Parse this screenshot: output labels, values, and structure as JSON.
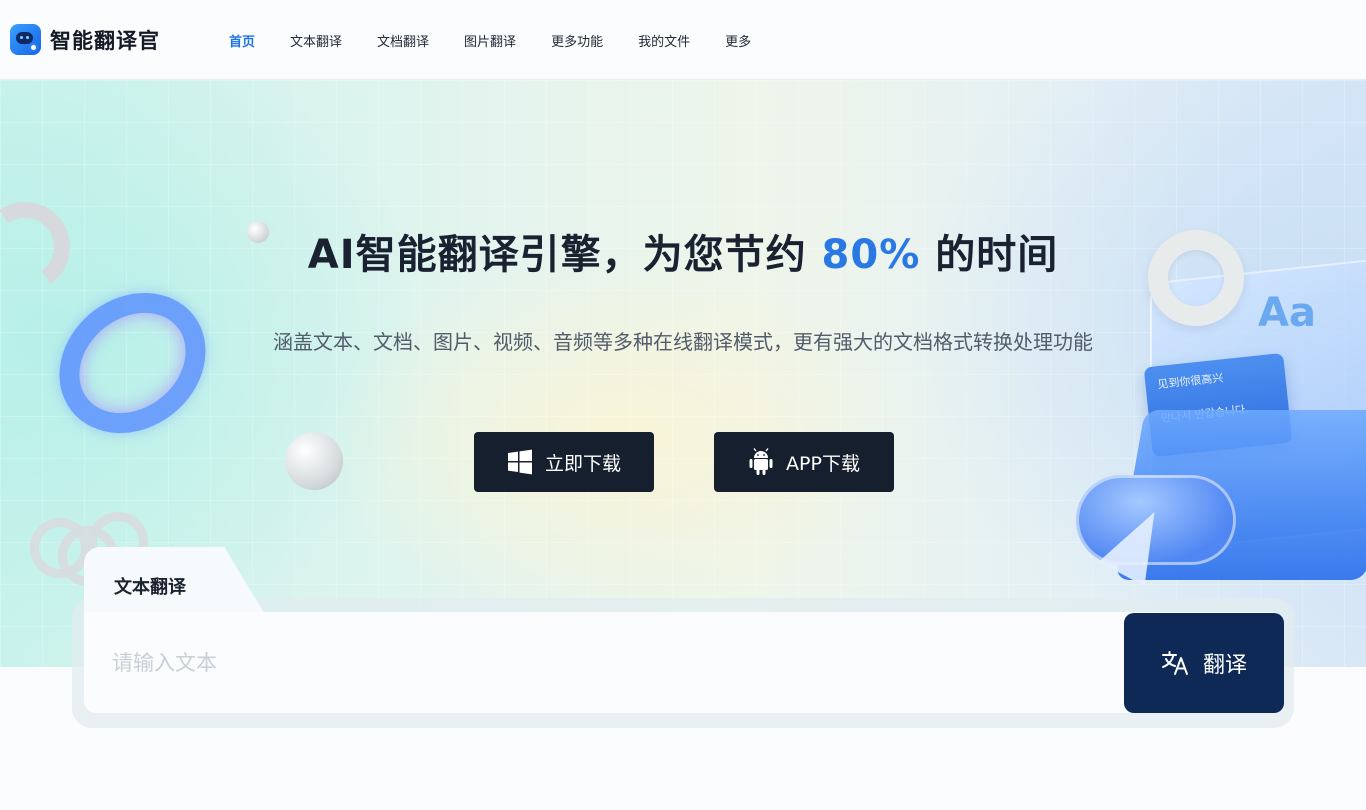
{
  "app": {
    "name": "智能翻译官"
  },
  "nav": {
    "items": [
      {
        "label": "首页",
        "active": true
      },
      {
        "label": "文本翻译"
      },
      {
        "label": "文档翻译"
      },
      {
        "label": "图片翻译"
      },
      {
        "label": "更多功能"
      },
      {
        "label": "我的文件"
      },
      {
        "label": "更多"
      }
    ]
  },
  "hero": {
    "title_prefix": "AI智能翻译引擎，为您节约",
    "title_accent": "80%",
    "title_suffix": "的时间",
    "subtitle": "涵盖文本、文档、图片、视频、音频等多种在线翻译模式，更有强大的文档格式转换处理功能",
    "download_label": "立即下载",
    "app_download_label": "APP下载",
    "download_icon": "windows-icon",
    "app_icon": "android-icon",
    "illustration": {
      "aa": "Aa",
      "card_line_1": "见到你很高兴",
      "card_line_2": "만나서 반갑습니다."
    }
  },
  "translate": {
    "tab_label": "文本翻译",
    "input_placeholder": "请输入文本",
    "input_value": "",
    "button_label": "翻译",
    "button_icon": "translate-icon"
  },
  "colors": {
    "accent": "#2a78e4",
    "nav_active": "#1e73e8",
    "dark_button": "#161f2e",
    "translate_button": "#0e2955"
  }
}
